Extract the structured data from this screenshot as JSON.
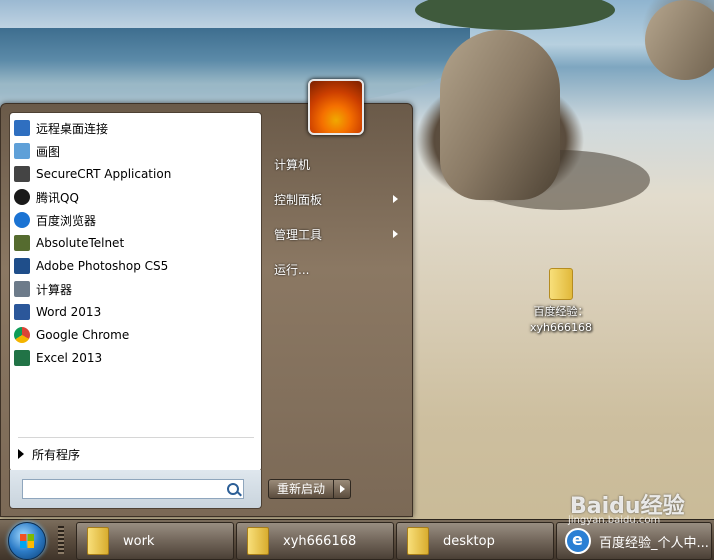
{
  "desktop": {
    "icon": {
      "label_line1": "百度经验：",
      "label_line2": "xyh666168"
    }
  },
  "start_menu": {
    "programs": [
      {
        "label": "远程桌面连接",
        "icon": "remote-desktop-icon",
        "color": "#2f6fc0"
      },
      {
        "label": "画图",
        "icon": "paint-icon",
        "color": "#5fa0d8"
      },
      {
        "label": "SecureCRT Application",
        "icon": "securecrt-icon",
        "color": "#444444"
      },
      {
        "label": "腾讯QQ",
        "icon": "qq-icon",
        "color": "#1a1a1a"
      },
      {
        "label": "百度浏览器",
        "icon": "baidu-browser-icon",
        "color": "#1b73d3"
      },
      {
        "label": "AbsoluteTelnet",
        "icon": "absolutetelnet-icon",
        "color": "#556b2f"
      },
      {
        "label": "Adobe Photoshop CS5",
        "icon": "photoshop-icon",
        "color": "#1f4e8a"
      },
      {
        "label": "计算器",
        "icon": "calculator-icon",
        "color": "#6d7b8a"
      },
      {
        "label": "Word 2013",
        "icon": "word-icon",
        "color": "#2b579a"
      },
      {
        "label": "Google Chrome",
        "icon": "chrome-icon",
        "color": "#db4437"
      },
      {
        "label": "Excel 2013",
        "icon": "excel-icon",
        "color": "#217346"
      }
    ],
    "all_programs": "所有程序",
    "search_placeholder": "",
    "right": [
      {
        "label": "计算机",
        "submenu": false
      },
      {
        "label": "控制面板",
        "submenu": true
      },
      {
        "label": "管理工具",
        "submenu": true
      },
      {
        "label": "运行...",
        "submenu": false
      }
    ],
    "shutdown_label": "重新启动"
  },
  "taskbar": {
    "items": [
      {
        "label": "work",
        "icon": "folder-icon"
      },
      {
        "label": "xyh666168",
        "icon": "folder-icon"
      },
      {
        "label": "desktop",
        "icon": "folder-icon"
      },
      {
        "label": "百度经验_个人中...",
        "icon": "browser-icon"
      }
    ]
  },
  "watermark": {
    "text": "Baidu经验",
    "sub": "jingyan.baidu.com"
  }
}
